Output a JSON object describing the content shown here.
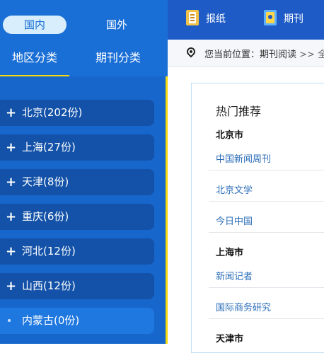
{
  "sidebar": {
    "scope_domestic": "国内",
    "scope_foreign": "国外",
    "tab_region": "地区分类",
    "tab_journal": "期刊分类",
    "regions": [
      {
        "label": "北京(202份)"
      },
      {
        "label": "上海(27份)"
      },
      {
        "label": "天津(8份)"
      },
      {
        "label": "重庆(6份)"
      },
      {
        "label": "河北(12份)"
      },
      {
        "label": "山西(12份)"
      },
      {
        "label": "内蒙古(0份)"
      }
    ]
  },
  "topnav": {
    "newspaper": "报纸",
    "journal": "期刊"
  },
  "breadcrumb": {
    "prefix": "您当前位置：",
    "current": "期刊阅读",
    "sep": " >> 全"
  },
  "hot": {
    "title": "热门推荐",
    "beijing": "北京市",
    "bj_items": [
      "中国新闻周刊",
      "北京文学",
      "今日中国"
    ],
    "shanghai": "上海市",
    "sh_items": [
      "新闻记者",
      "国际商务研究"
    ],
    "tianjin": "天津市"
  },
  "colors": {
    "sidebar_bg": "#1a6fd6",
    "accent_yellow": "#f5d90a",
    "link_blue": "#2a6db8"
  },
  "icons": {
    "newspaper": "newspaper-icon",
    "journal": "journal-icon",
    "location": "location-pin-icon",
    "expand": "plus-icon"
  }
}
